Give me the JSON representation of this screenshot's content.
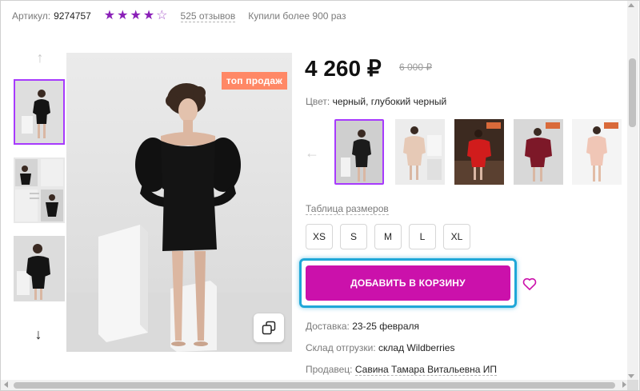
{
  "meta": {
    "article_label": "Артикул:",
    "article_value": "9274757",
    "rating_stars": 4,
    "rating_max": 5,
    "reviews": "525 отзывов",
    "bought": "Купили более 900 раз"
  },
  "gallery": {
    "badge": "топ продаж",
    "thumbnails": [
      "photo-1",
      "photo-2",
      "photo-3"
    ],
    "active_index": 0
  },
  "product": {
    "price": "4 260 ₽",
    "old_price": "6 000 ₽",
    "color_label": "Цвет:",
    "color_value": "черный, глубокий черный",
    "variants": [
      {
        "color": "#1b1b1b",
        "bg": "#cfcfcf"
      },
      {
        "color": "#e6c9b6",
        "bg": "#ececec"
      },
      {
        "color": "#d11c1c",
        "bg": "#3c2a20"
      },
      {
        "color": "#7d1828",
        "bg": "#d8d8d8"
      },
      {
        "color": "#f0c6b6",
        "bg": "#f4f4f4"
      }
    ],
    "size_table": "Таблица размеров",
    "sizes": [
      "XS",
      "S",
      "M",
      "L",
      "XL"
    ],
    "add_to_cart": "ДОБАВИТЬ В КОРЗИНУ",
    "delivery_label": "Доставка:",
    "delivery_value": "23-25 февраля",
    "warehouse_label": "Склад отгрузки:",
    "warehouse_value": "склад Wildberries",
    "seller_label": "Продавец:",
    "seller_value": "Савина Тамара Витальевна ИП"
  },
  "colors": {
    "accent": "#cb11ab",
    "selection": "#a73afd",
    "highlight": "#1fa7d8",
    "badge": "#ff8866"
  }
}
